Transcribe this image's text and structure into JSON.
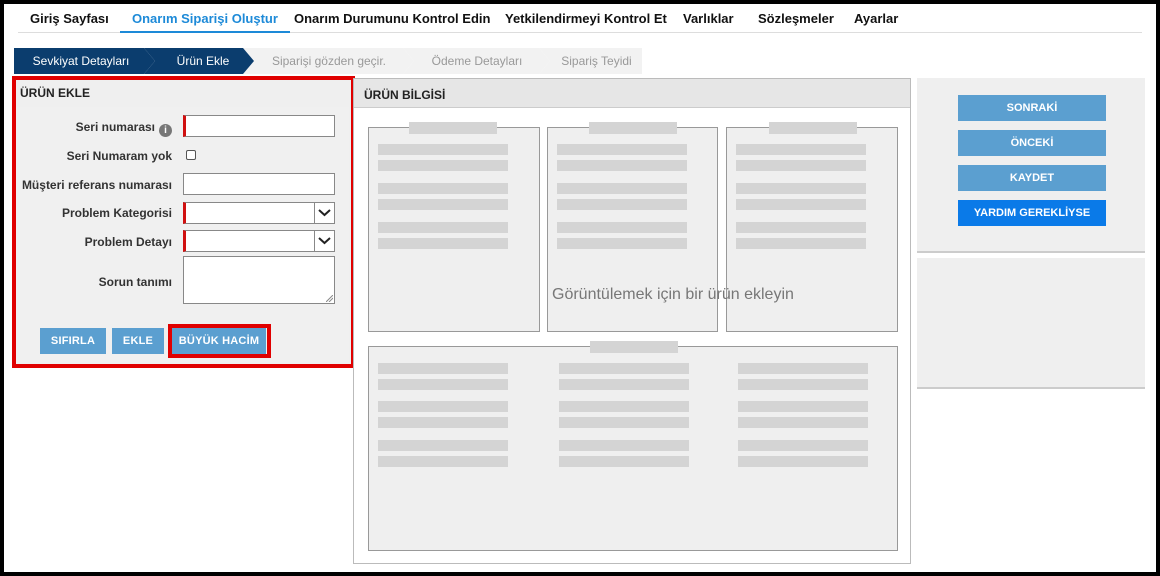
{
  "nav": {
    "items": [
      {
        "label": "Giriş Sayfası"
      },
      {
        "label": "Onarım Siparişi Oluştur"
      },
      {
        "label": "Onarım Durumunu Kontrol Edin"
      },
      {
        "label": "Yetkilendirmeyi Kontrol Et"
      },
      {
        "label": "Varlıklar"
      },
      {
        "label": "Sözleşmeler"
      },
      {
        "label": "Ayarlar"
      }
    ],
    "active_index": 1,
    "active_color": "#1d8ad8"
  },
  "steps": [
    {
      "label": "Sevkiyat Detayları",
      "state": "done"
    },
    {
      "label": "Ürün Ekle",
      "state": "current"
    },
    {
      "label": "Siparişi gözden geçir.",
      "state": "pending"
    },
    {
      "label": "Ödeme Detayları",
      "state": "pending"
    },
    {
      "label": "Sipariş Teyidi",
      "state": "pending"
    }
  ],
  "add_product": {
    "title": "ÜRÜN EKLE",
    "serial_label": "Seri numarası",
    "serial_value": "",
    "no_serial_label": "Seri Numaram yok",
    "no_serial_checked": false,
    "customer_ref_label": "Müşteri referans numarası",
    "customer_ref_value": "",
    "problem_category_label": "Problem Kategorisi",
    "problem_category_value": "",
    "problem_detail_label": "Problem Detayı",
    "problem_detail_value": "",
    "issue_description_label": "Sorun tanımı",
    "buttons": {
      "reset": "SIFIRLA",
      "add": "EKLE",
      "bulk": "BÜYÜK HACİM"
    }
  },
  "product_info": {
    "title": "ÜRÜN BİLGİSİ",
    "empty_message": "Görüntülemek için bir ürün ekleyin"
  },
  "actions": {
    "next": "SONRAKİ",
    "previous": "ÖNCEKİ",
    "save": "KAYDET",
    "help": "YARDIM GEREKLİYSE"
  },
  "colors": {
    "step_active": "#0b3d6e",
    "button": "#5b9fd0",
    "help_button": "#0a7ae8",
    "highlight": "#e00000"
  }
}
